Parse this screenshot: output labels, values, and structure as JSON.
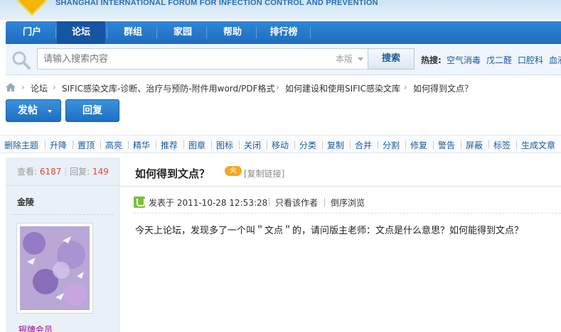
{
  "banner": {
    "forum_name": "SHANGHAI INTERNATIONAL FORUM FOR INFECTION CONTROL AND PREVENTION",
    "logo_icon": "diamond-logo-icon"
  },
  "nav": {
    "items": [
      {
        "label": "门户",
        "active": false
      },
      {
        "label": "论坛",
        "active": true
      },
      {
        "label": "群组",
        "active": false
      },
      {
        "label": "家园",
        "active": false
      },
      {
        "label": "帮助",
        "active": false
      },
      {
        "label": "排行榜",
        "active": false
      }
    ]
  },
  "search": {
    "placeholder": "请输入搜索内容",
    "scope": "本版",
    "button_label": "搜索",
    "hot_label": "热搜:",
    "hot_terms": [
      "空气消毒",
      "戊二醛",
      "口腔科",
      "血液"
    ]
  },
  "breadcrumb": {
    "items": [
      "论坛",
      "SIFIC感染文库-诊断、治疗与预防-附件用word/PDF格式",
      "如何建设和使用SIFIC感染文库",
      "如何得到文点？"
    ]
  },
  "actions": {
    "post_label": "发帖",
    "reply_label": "回复"
  },
  "moderation": {
    "items": [
      "删除主题",
      "升降",
      "置顶",
      "高亮",
      "精华",
      "推荐",
      "图章",
      "图标",
      "关闭",
      "移动",
      "分类",
      "复制",
      "合并",
      "分割",
      "修复",
      "警告",
      "屏蔽",
      "标签",
      "生成文章"
    ]
  },
  "thread": {
    "views_label": "查看:",
    "views": "6187",
    "replies_label": "回复:",
    "replies": "149",
    "title": "如何得到文点？",
    "hot_badge": "火",
    "copy_link": "[复制链接]"
  },
  "post": {
    "author": "金陵",
    "member_rank": "银牌会员",
    "posted_at": "发表于 2011-10-28 12:53:28",
    "only_author": "只看该作者",
    "reverse_order": "倒序浏览",
    "body": "今天上论坛，发现多了一个叫＂文点＂的，请问版主老师：文点是什么意思？如何能得到文点？"
  },
  "colors": {
    "nav_bg": "#1f6cc0",
    "nav_active": "#1556a2",
    "link": "#1a5a9c",
    "stat_number": "#e4443d",
    "rank": "#a000a0",
    "hot_badge": "#f5a623"
  }
}
